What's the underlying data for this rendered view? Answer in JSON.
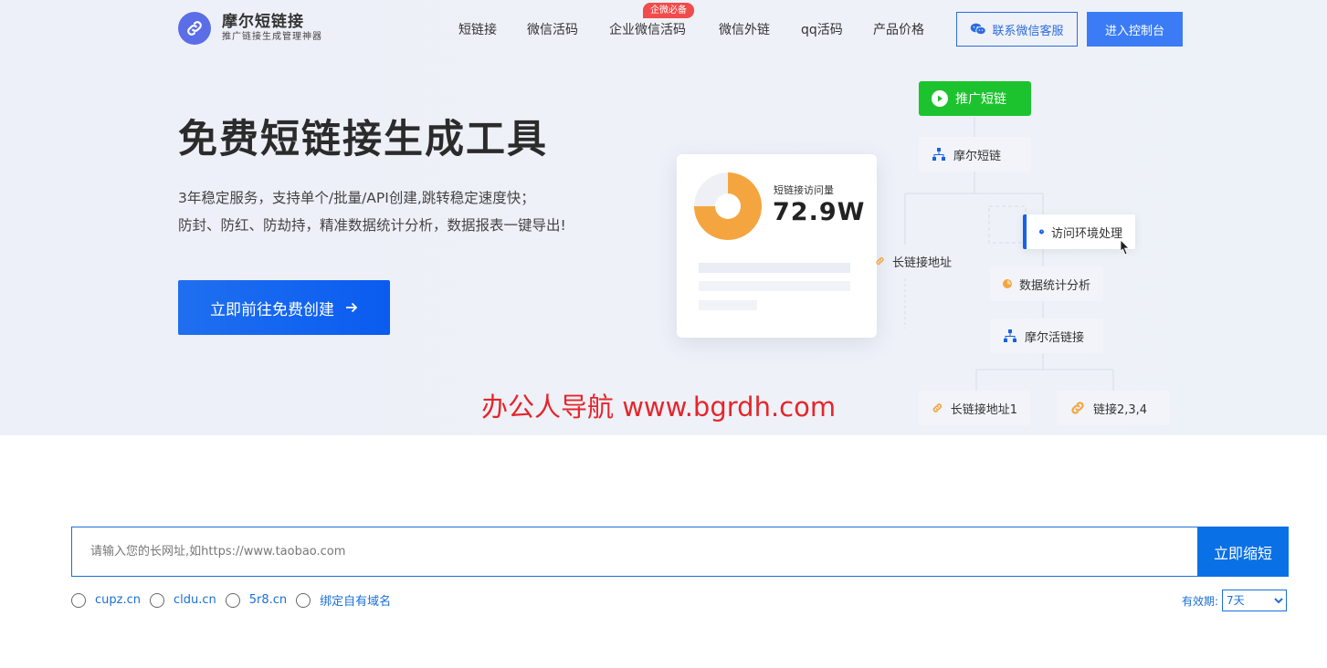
{
  "brand": {
    "name": "摩尔短链接",
    "tagline": "推广链接生成管理神器"
  },
  "nav": {
    "items": [
      "短链接",
      "微信活码",
      "企业微信活码",
      "微信外链",
      "qq活码",
      "产品价格"
    ],
    "badge": "企微必备",
    "wechat_service": "联系微信客服",
    "console": "进入控制台"
  },
  "hero": {
    "title": "免费短链接生成工具",
    "desc_line1": "3年稳定服务，支持单个/批量/API创建,跳转稳定速度快；",
    "desc_line2": "防封、防红、防劫持，精准数据统计分析，数据报表一键导出!",
    "cta": "立即前往免费创建"
  },
  "stats_card": {
    "label": "短链接访问量",
    "value": "72.9W",
    "progress": 0.75
  },
  "flow": {
    "promo": "推广短链",
    "moer_short": "摩尔短链",
    "env": "访问环境处理",
    "long_url": "长链接地址",
    "analytics": "数据统计分析",
    "moer_live": "摩尔活链接",
    "long_url_1": "长链接地址1",
    "links_234": "链接2,3,4"
  },
  "watermark": "办公人导航 www.bgrdh.com",
  "search": {
    "placeholder": "请输入您的长网址,如https://www.taobao.com",
    "button": "立即缩短"
  },
  "domains": [
    "cupz.cn",
    "cldu.cn",
    "5r8.cn",
    "绑定自有域名"
  ],
  "expiry": {
    "label": "有效期:",
    "selected": "7天"
  },
  "colors": {
    "primary": "#0a70e6",
    "green": "#1dc32e",
    "badge": "#f14b4b",
    "orange": "#f5a540"
  }
}
